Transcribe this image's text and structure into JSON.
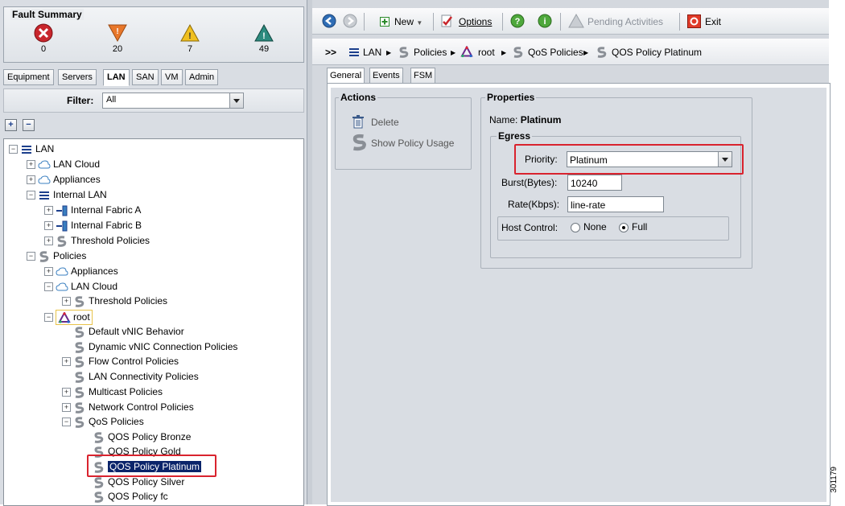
{
  "fault_summary": {
    "title": "Fault Summary",
    "critical": "0",
    "major": "20",
    "minor": "7",
    "warning": "49"
  },
  "nav_tabs": [
    "Equipment",
    "Servers",
    "LAN",
    "SAN",
    "VM",
    "Admin"
  ],
  "filter": {
    "label": "Filter:",
    "value": "All"
  },
  "tree": {
    "lan": "LAN",
    "lan_cloud": "LAN Cloud",
    "appliances": "Appliances",
    "internal_lan": "Internal LAN",
    "fabric_a": "Internal Fabric A",
    "fabric_b": "Internal Fabric B",
    "threshold_policies": "Threshold Policies",
    "policies": "Policies",
    "pol_appliances": "Appliances",
    "pol_lan_cloud": "LAN Cloud",
    "pol_threshold": "Threshold Policies",
    "root": "root",
    "default_vnic": "Default vNIC Behavior",
    "dynamic_vnic": "Dynamic vNIC Connection Policies",
    "flow_control": "Flow Control Policies",
    "lan_connectivity": "LAN Connectivity Policies",
    "multicast": "Multicast Policies",
    "network_control": "Network Control Policies",
    "qos_policies": "QoS Policies",
    "qos_bronze": "QOS Policy Bronze",
    "qos_gold": "QOS Policy Gold",
    "qos_platinum": "QOS Policy Platinum",
    "qos_silver": "QOS Policy Silver",
    "qos_fc": "QOS Policy fc"
  },
  "toolbar": {
    "new": "New",
    "options": "Options",
    "pending": "Pending Activities",
    "exit": "Exit"
  },
  "breadcrumb": {
    "prefix": ">>",
    "items": [
      "LAN",
      "Policies",
      "root",
      "QoS Policies",
      "QOS Policy Platinum"
    ]
  },
  "detail_tabs": [
    "General",
    "Events",
    "FSM"
  ],
  "actions": {
    "title": "Actions",
    "delete": "Delete",
    "show_usage": "Show Policy Usage"
  },
  "properties": {
    "title": "Properties",
    "name_label": "Name:",
    "name_value": "Platinum",
    "egress_title": "Egress",
    "priority_label": "Priority:",
    "priority_value": "Platinum",
    "burst_label": "Burst(Bytes):",
    "burst_value": "10240",
    "rate_label": "Rate(Kbps):",
    "rate_value": "line-rate",
    "host_label": "Host Control:",
    "host_none": "None",
    "host_full": "Full"
  },
  "figure_number": "301179",
  "colors": {
    "highlight": "#d9232e",
    "selection": "#0a246a",
    "critical": "#c8262c",
    "major": "#e8772a",
    "minor": "#f0c020",
    "warning": "#2c8a7e"
  }
}
